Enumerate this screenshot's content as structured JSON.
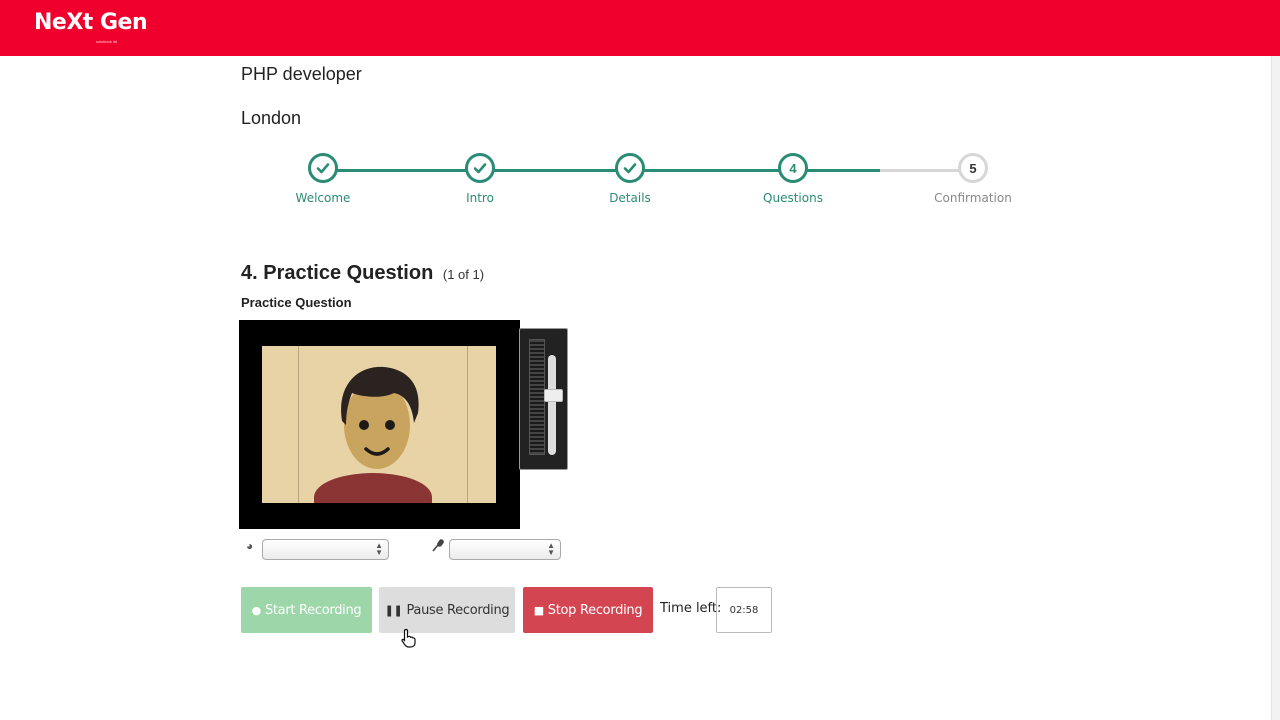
{
  "brand": {
    "logo_text": "NeXt Gen",
    "logo_sub": "solutions ltd",
    "color": "#f0002c"
  },
  "job": {
    "title": "PHP developer",
    "location": "London"
  },
  "stepper": {
    "accent": "#2b8c75",
    "steps": [
      {
        "num": "",
        "label": "Welcome",
        "status": "done"
      },
      {
        "num": "",
        "label": "Intro",
        "status": "done"
      },
      {
        "num": "",
        "label": "Details",
        "status": "done"
      },
      {
        "num": "4",
        "label": "Questions",
        "status": "current"
      },
      {
        "num": "5",
        "label": "Confirmation",
        "status": "todo"
      }
    ]
  },
  "question": {
    "heading": "4. Practice Question",
    "count": "(1 of 1)",
    "subheading": "Practice Question"
  },
  "devices": {
    "camera_select": "",
    "mic_select": ""
  },
  "controls": {
    "start_label": "Start Recording",
    "pause_label": "Pause Recording",
    "stop_label": "Stop Recording",
    "time_left_label": "Time left:",
    "time_left_value": "02:58"
  }
}
